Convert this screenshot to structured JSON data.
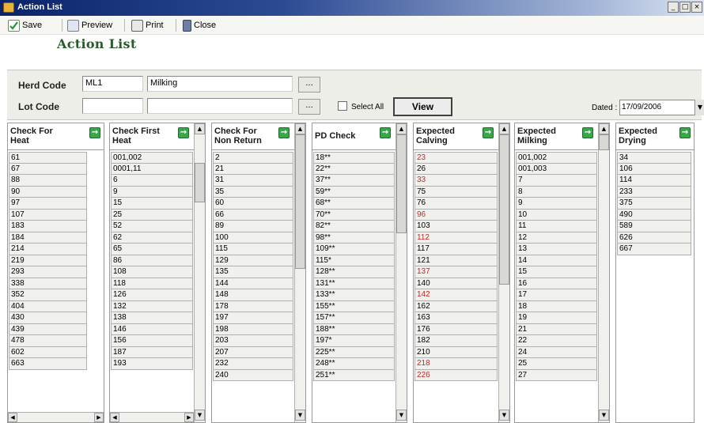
{
  "window": {
    "title": "Action List",
    "minimize": "_",
    "maximize": "□",
    "close": "×"
  },
  "toolbar": {
    "save": "Save",
    "preview": "Preview",
    "print": "Print",
    "close": "Close"
  },
  "heading": "Action List",
  "filters": {
    "herd_code_label": "Herd Code",
    "herd_code_value": "ML1",
    "herd_name_value": "Milking",
    "lot_code_label": "Lot Code",
    "lot_code_value": "",
    "lot_name_value": "",
    "ellipsis": "...",
    "select_all_label": "Select All",
    "view_button": "View",
    "dated_label": "Dated :",
    "dated_value": "17/09/2006"
  },
  "columns": [
    {
      "id": "check-for-heat",
      "title_line1": "Check For",
      "title_line2": "Heat",
      "rows": [
        "61",
        "67",
        "88",
        "90",
        "97",
        "107",
        "183",
        "184",
        "214",
        "219",
        "293",
        "338",
        "352",
        "404",
        "430",
        "439",
        "478",
        "602",
        "663"
      ],
      "red": []
    },
    {
      "id": "check-first-heat",
      "title_line1": "Check First",
      "title_line2": "Heat",
      "rows": [
        "001,002",
        "0001,11",
        "6",
        "9",
        "15",
        "25",
        "52",
        "62",
        "65",
        "86",
        "108",
        "118",
        "126",
        "132",
        "138",
        "146",
        "156",
        "187",
        "193"
      ],
      "red": []
    },
    {
      "id": "check-for-non-return",
      "title_line1": "Check For",
      "title_line2": "Non Return",
      "rows": [
        "2",
        "21",
        "31",
        "35",
        "60",
        "66",
        "89",
        "100",
        "115",
        "129",
        "135",
        "144",
        "148",
        "178",
        "197",
        "198",
        "203",
        "207",
        "232",
        "240"
      ],
      "red": []
    },
    {
      "id": "pd-check",
      "title_line1": "PD Check",
      "title_line2": "",
      "rows": [
        "18**",
        "22**",
        "37**",
        "59**",
        "68**",
        "70**",
        "82**",
        "98**",
        "109**",
        "115*",
        "128**",
        "131**",
        "133**",
        "155**",
        "157**",
        "188**",
        "197*",
        "225**",
        "248**",
        "251**"
      ],
      "red": []
    },
    {
      "id": "expected-calving",
      "title_line1": "Expected",
      "title_line2": "Calving",
      "rows": [
        "23",
        "26",
        "33",
        "75",
        "76",
        "96",
        "103",
        "112",
        "117",
        "121",
        "137",
        "140",
        "142",
        "162",
        "163",
        "176",
        "182",
        "210",
        "218",
        "226"
      ],
      "red": [
        0,
        2,
        5,
        7,
        10,
        12,
        18,
        19
      ]
    },
    {
      "id": "expected-milking",
      "title_line1": "Expected",
      "title_line2": "Milking",
      "rows": [
        "001,002",
        "001,003",
        "7",
        "8",
        "9",
        "10",
        "11",
        "12",
        "13",
        "14",
        "15",
        "16",
        "17",
        "18",
        "19",
        "21",
        "22",
        "24",
        "25",
        "27"
      ],
      "red": []
    },
    {
      "id": "expected-drying",
      "title_line1": "Expected",
      "title_line2": "Drying",
      "rows": [
        "34",
        "106",
        "114",
        "233",
        "375",
        "490",
        "589",
        "626",
        "667"
      ],
      "red": []
    }
  ],
  "colors": {
    "red_value": "#c82828",
    "heading_green": "#2b5a2b",
    "go_icon_green": "#3aa84a"
  }
}
